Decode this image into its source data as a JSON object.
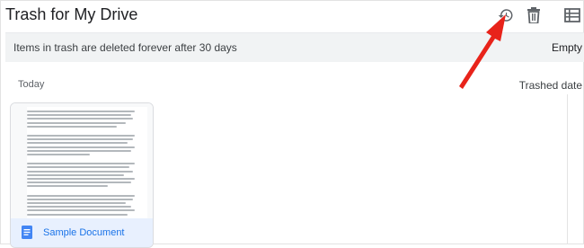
{
  "header": {
    "title": "Trash for My Drive",
    "icons": [
      "restore-history-icon",
      "trash-icon",
      "list-view-icon"
    ]
  },
  "banner": {
    "message": "Items in trash are deleted forever after 30 days",
    "action_label": "Empty"
  },
  "content": {
    "section_label": "Today",
    "sort_label": "Trashed date",
    "files": [
      {
        "name": "Sample Document",
        "icon": "google-docs-icon"
      }
    ]
  },
  "colors": {
    "accent": "#1a73e8",
    "banner_bg": "#f1f3f4",
    "annotation_arrow": "#e8231a",
    "card_footer_bg": "#e8f0fe"
  }
}
